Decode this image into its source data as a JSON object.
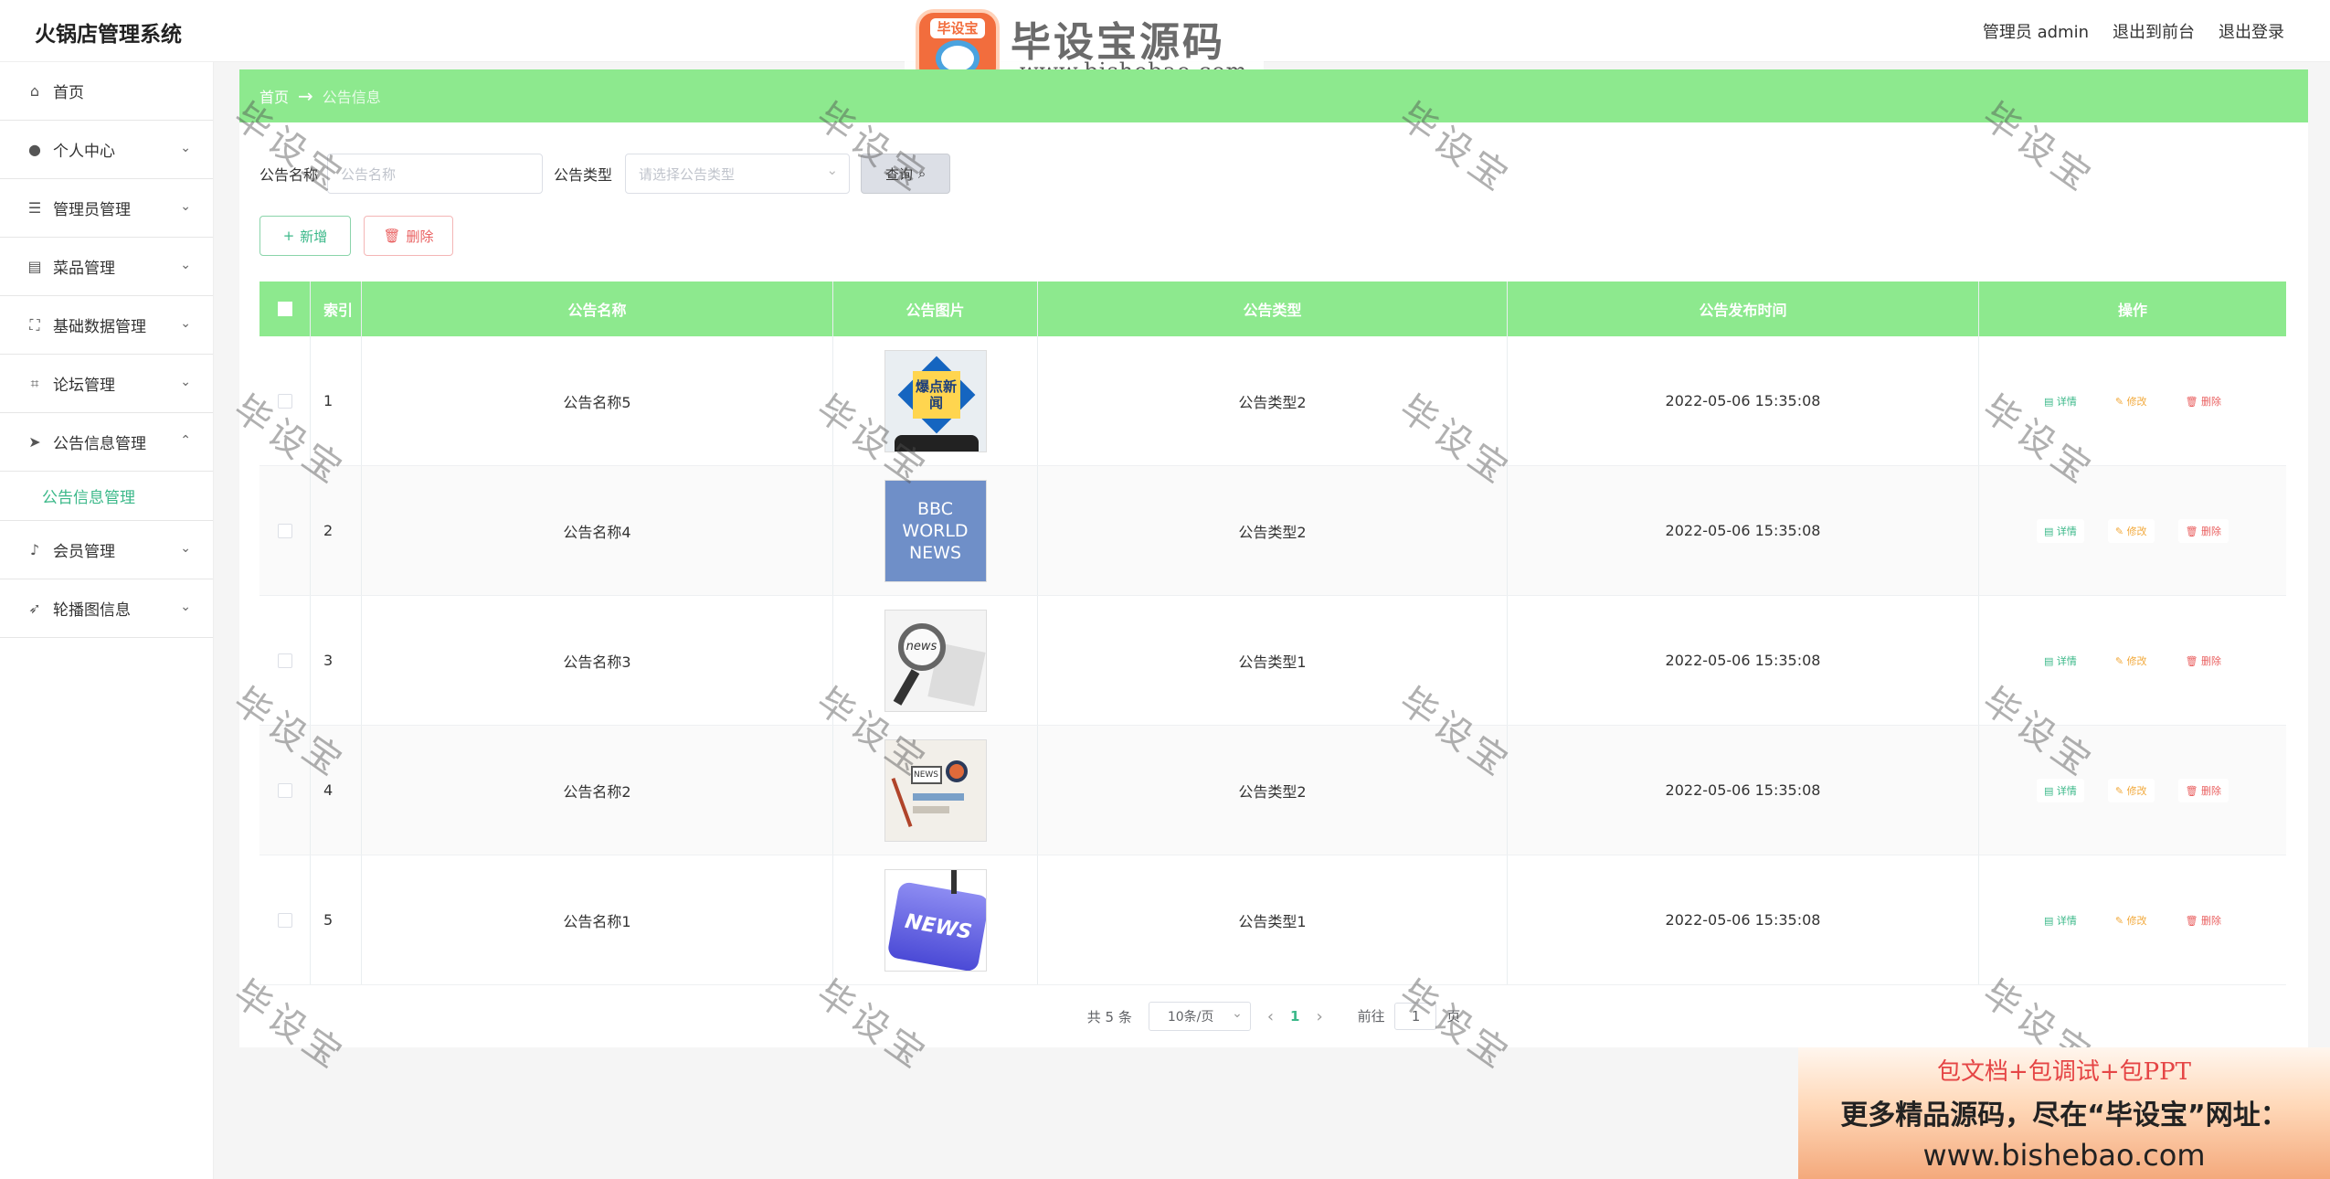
{
  "header": {
    "app_title": "火锅店管理系统",
    "user_label": "管理员 admin",
    "to_front": "退出到前台",
    "logout": "退出登录"
  },
  "brand": {
    "badge_text": "毕设宝",
    "name": "毕设宝源码网",
    "url": "www.bishebao.com"
  },
  "sidebar": {
    "items": [
      {
        "label": "首页",
        "icon": "home-icon"
      },
      {
        "label": "个人中心",
        "icon": "user-icon"
      },
      {
        "label": "管理员管理",
        "icon": "menu-icon"
      },
      {
        "label": "菜品管理",
        "icon": "clipboard-icon"
      },
      {
        "label": "基础数据管理",
        "icon": "fullscreen-icon"
      },
      {
        "label": "论坛管理",
        "icon": "crop-icon"
      },
      {
        "label": "公告信息管理",
        "icon": "send-icon"
      },
      {
        "label": "会员管理",
        "icon": "microphone-icon"
      },
      {
        "label": "轮播图信息",
        "icon": "location-icon"
      }
    ],
    "sub_item": "公告信息管理"
  },
  "breadcrumb": {
    "home": "首页",
    "current": "公告信息"
  },
  "search": {
    "name_label": "公告名称",
    "name_placeholder": "公告名称",
    "type_label": "公告类型",
    "type_placeholder": "请选择公告类型",
    "query_button": "查询"
  },
  "actions": {
    "add": "新增",
    "delete": "删除"
  },
  "table": {
    "headers": {
      "index": "索引",
      "name": "公告名称",
      "image": "公告图片",
      "type": "公告类型",
      "time": "公告发布时间",
      "ops": "操作"
    },
    "rows": [
      {
        "index": "1",
        "name": "公告名称5",
        "type": "公告类型2",
        "time": "2022-05-06 15:35:08",
        "image": "爆点新闻"
      },
      {
        "index": "2",
        "name": "公告名称4",
        "type": "公告类型2",
        "time": "2022-05-06 15:35:08",
        "image": "BBC WORLD NEWS"
      },
      {
        "index": "3",
        "name": "公告名称3",
        "type": "公告类型1",
        "time": "2022-05-06 15:35:08",
        "image": "news"
      },
      {
        "index": "4",
        "name": "公告名称2",
        "type": "公告类型2",
        "time": "2022-05-06 15:35:08",
        "image": "NEWS"
      },
      {
        "index": "5",
        "name": "公告名称1",
        "type": "公告类型1",
        "time": "2022-05-06 15:35:08",
        "image": "NEWS"
      }
    ],
    "op_detail": "详情",
    "op_edit": "修改",
    "op_delete": "删除"
  },
  "pagination": {
    "total": "共 5 条",
    "page_size": "10条/页",
    "current_page": "1",
    "goto_prefix": "前往",
    "goto_value": "1",
    "goto_suffix": "页"
  },
  "watermark_text": "毕设宝",
  "promo": {
    "line1": "包文档+包调试+包PPT",
    "line2": "更多精品源码，尽在“毕设宝”网址：",
    "line3": "www.bishebao.com"
  }
}
